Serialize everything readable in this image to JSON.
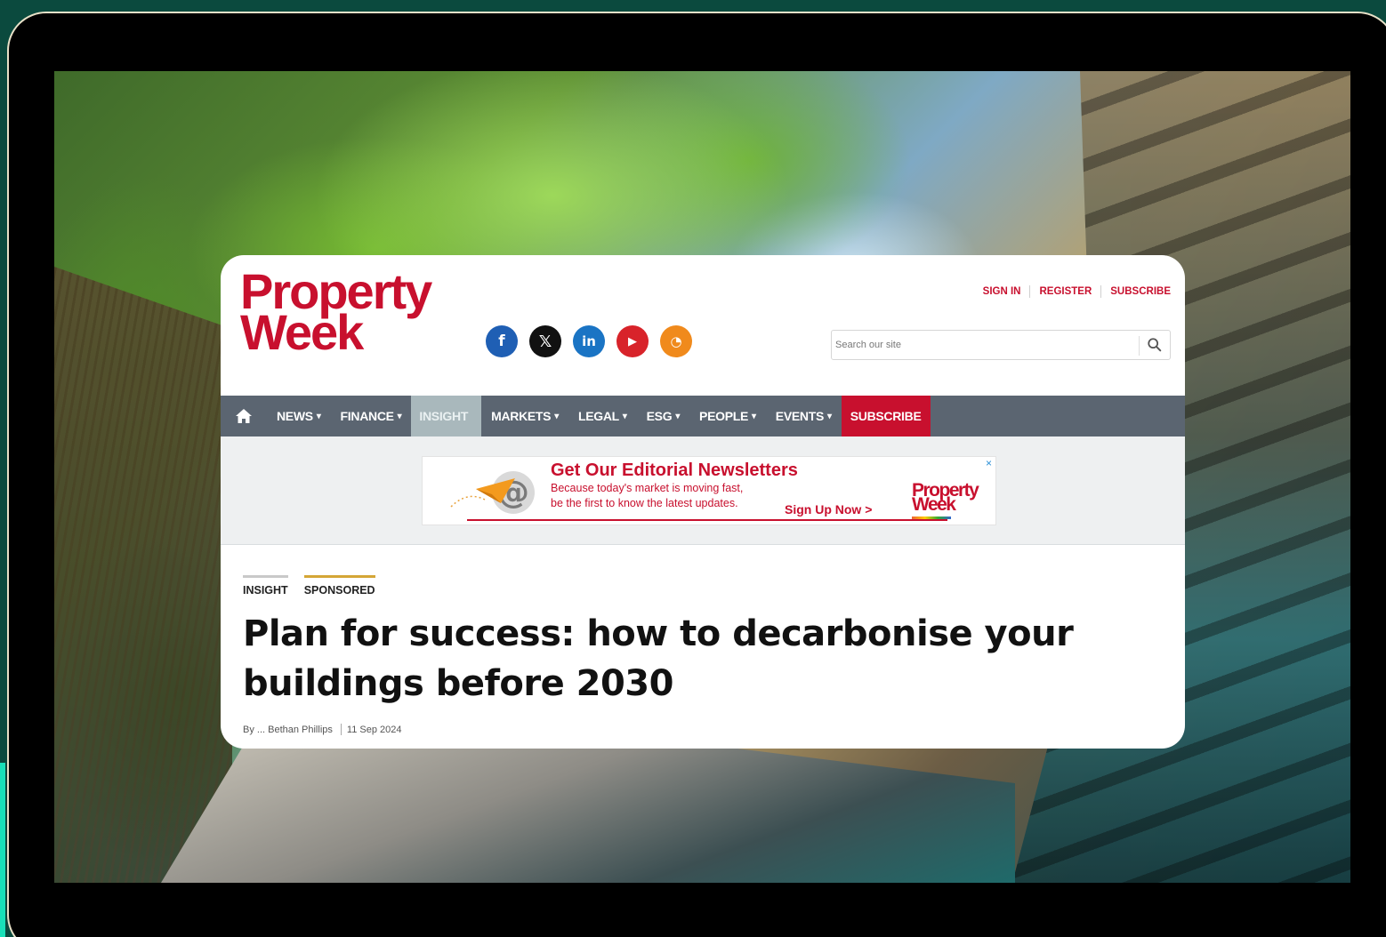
{
  "site": {
    "logo_line1": "Property",
    "logo_line2": "Week",
    "brand_color": "#c8102e"
  },
  "social": [
    {
      "name": "facebook-icon",
      "glyph": "f",
      "color": "#1f5fb4"
    },
    {
      "name": "x-icon",
      "glyph": "𝕏",
      "color": "#111111"
    },
    {
      "name": "linkedin-icon",
      "glyph": "in",
      "color": "#1a74c4"
    },
    {
      "name": "youtube-icon",
      "glyph": "▶",
      "color": "#d8232a"
    },
    {
      "name": "rss-icon",
      "glyph": "◔",
      "color": "#f08a1c"
    }
  ],
  "top_links": {
    "sign_in": "SIGN IN",
    "register": "REGISTER",
    "subscribe": "SUBSCRIBE"
  },
  "search": {
    "placeholder": "Search our site"
  },
  "nav": {
    "items": [
      {
        "label": "NEWS",
        "caret": "▾"
      },
      {
        "label": "FINANCE",
        "caret": "▾"
      },
      {
        "label": "INSIGHT",
        "caret": ""
      },
      {
        "label": "MARKETS",
        "caret": "▾"
      },
      {
        "label": "LEGAL",
        "caret": "▾"
      },
      {
        "label": "ESG",
        "caret": "▾"
      },
      {
        "label": "PEOPLE",
        "caret": "▾"
      },
      {
        "label": "EVENTS",
        "caret": "▾"
      },
      {
        "label": "SUBSCRIBE",
        "caret": ""
      }
    ]
  },
  "ad": {
    "title": "Get Our Editorial Newsletters",
    "line1": "Because today's market is moving fast,",
    "line2": "be the first to know the latest updates.",
    "cta": "Sign Up Now >",
    "logo_line1": "Property",
    "logo_line2": "Week",
    "close": "×"
  },
  "article": {
    "tag1": "INSIGHT",
    "tag2": "SPONSORED",
    "headline": "Plan for success: how to decarbonise your buildings before 2030",
    "byline": "By ... Bethan Phillips",
    "date": "11 Sep 2024"
  }
}
